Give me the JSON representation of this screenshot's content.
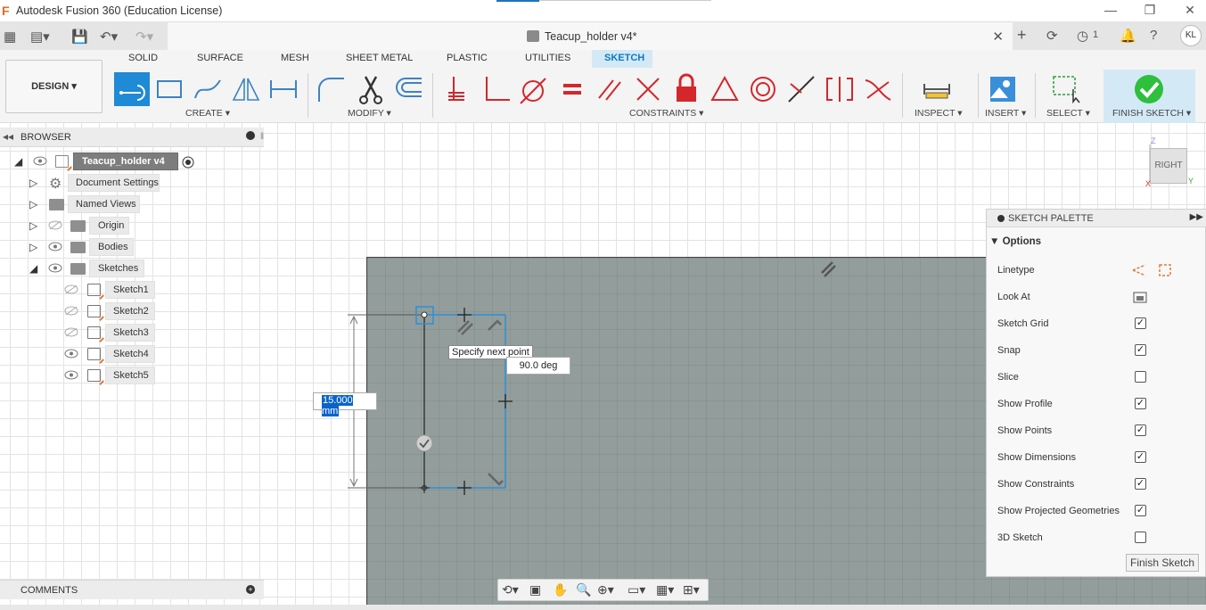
{
  "window": {
    "title": "Autodesk Fusion 360 (Education License)",
    "minimize": "—",
    "maximize": "❐",
    "close": "✕"
  },
  "document": {
    "title": "Teacup_holder v4*",
    "close": "✕",
    "job_count": "1",
    "user_initials": "KL"
  },
  "ribbon": {
    "workspace": "DESIGN ▾",
    "tabs": [
      "SOLID",
      "SURFACE",
      "MESH",
      "SHEET METAL",
      "PLASTIC",
      "UTILITIES",
      "SKETCH"
    ],
    "groups": {
      "create": "CREATE ▾",
      "modify": "MODIFY ▾",
      "constraints": "CONSTRAINTS ▾",
      "inspect": "INSPECT ▾",
      "insert": "INSERT ▾",
      "select": "SELECT ▾",
      "finish": "FINISH SKETCH ▾"
    },
    "accent_color": "#0a7bc1",
    "constraint_color": "#d3272c"
  },
  "browser": {
    "title": "BROWSER",
    "root": "Teacup_holder v4",
    "items": [
      {
        "label": "Document Settings"
      },
      {
        "label": "Named Views"
      },
      {
        "label": "Origin"
      },
      {
        "label": "Bodies"
      },
      {
        "label": "Sketches"
      }
    ],
    "sketches": [
      "Sketch1",
      "Sketch2",
      "Sketch3",
      "Sketch4",
      "Sketch5"
    ]
  },
  "comments": {
    "title": "COMMENTS"
  },
  "palette": {
    "title": "SKETCH PALETTE",
    "section": "Options",
    "options": [
      {
        "label": "Linetype",
        "kind": "icons"
      },
      {
        "label": "Look At",
        "kind": "icon"
      },
      {
        "label": "Sketch Grid",
        "checked": "✓"
      },
      {
        "label": "Snap",
        "checked": "✓"
      },
      {
        "label": "Slice",
        "checked": ""
      },
      {
        "label": "Show Profile",
        "checked": "✓"
      },
      {
        "label": "Show Points",
        "checked": "✓"
      },
      {
        "label": "Show Dimensions",
        "checked": "✓"
      },
      {
        "label": "Show Constraints",
        "checked": "✓"
      },
      {
        "label": "Show Projected Geometries",
        "checked": "✓"
      },
      {
        "label": "3D Sketch",
        "checked": ""
      }
    ],
    "finish_button": "Finish Sketch"
  },
  "canvas": {
    "tooltip": "Specify next point",
    "angle": "90.0 deg",
    "dimension_value": "15.000 mm",
    "viewcube_face": "RIGHT",
    "axis_z": "Z",
    "axis_y": "Y",
    "axis_x": "X"
  }
}
